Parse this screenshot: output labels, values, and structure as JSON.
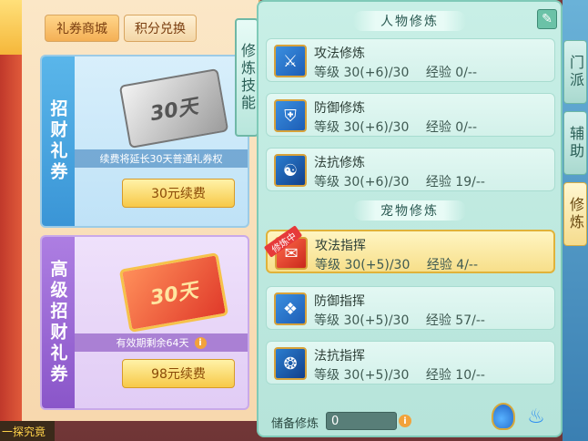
{
  "shop": {
    "tabs": [
      "礼券商城",
      "积分兑换"
    ],
    "cards": [
      {
        "label": "招财礼券",
        "ticket_text": "30天",
        "note": "续费将延长30天普通礼券权",
        "button": "30元续费"
      },
      {
        "label": "高级招财礼券",
        "ticket_text": "30天",
        "note": "有效期剩余64天",
        "button": "98元续费"
      }
    ],
    "bottom_text": "一探究竟"
  },
  "skills": {
    "side_tab": "修炼技能",
    "sections": {
      "character": "人物修炼",
      "pet": "宠物修炼"
    },
    "level_label": "等级",
    "exp_label": "经验",
    "character_skills": [
      {
        "name": "攻法修炼",
        "level": "30(+6)/30",
        "exp": "0/--",
        "icon": "attack-cultivation-icon"
      },
      {
        "name": "防御修炼",
        "level": "30(+6)/30",
        "exp": "0/--",
        "icon": "defense-cultivation-icon"
      },
      {
        "name": "法抗修炼",
        "level": "30(+6)/30",
        "exp": "19/--",
        "icon": "magic-resist-cultivation-icon"
      }
    ],
    "pet_skills": [
      {
        "name": "攻法指挥",
        "level": "30(+5)/30",
        "exp": "4/--",
        "icon": "attack-command-icon",
        "badge": "修炼中"
      },
      {
        "name": "防御指挥",
        "level": "30(+5)/30",
        "exp": "57/--",
        "icon": "defense-command-icon"
      },
      {
        "name": "法抗指挥",
        "level": "30(+5)/30",
        "exp": "10/--",
        "icon": "magic-resist-command-icon"
      }
    ],
    "reserve_label": "储备修炼",
    "reserve_value": "0"
  },
  "right_tabs": [
    "门派",
    "辅助",
    "修炼"
  ],
  "colors": {
    "panel_bg": "#c8efe6",
    "selected_row": "#f7df8a",
    "button_gold": "#f7c948"
  }
}
